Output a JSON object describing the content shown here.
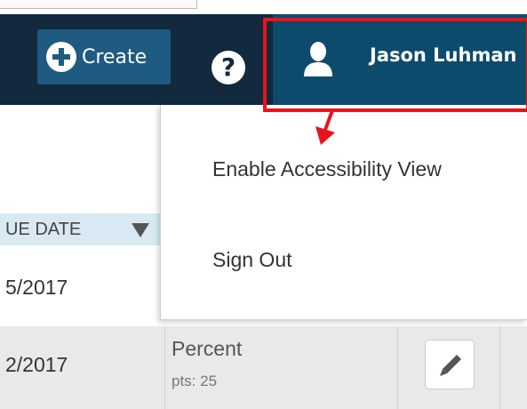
{
  "navbar": {
    "create_label": "Create",
    "help_symbol": "?",
    "user_name": "Jason Luhman",
    "icons": {
      "create": "plus-circle-icon",
      "help": "question-circle-icon",
      "user": "user-silhouette-icon"
    },
    "colors": {
      "navbar_bg": "#13293d",
      "create_bg": "#1f5a80",
      "user_menu_bg": "#0d4b6d",
      "highlight": "#e8141c"
    }
  },
  "dropdown": {
    "items": [
      {
        "label": "Enable Accessibility View"
      },
      {
        "label": "Sign Out"
      }
    ]
  },
  "table": {
    "columns": [
      {
        "label": "UE DATE",
        "sort_icon": "sort-down-triangle-icon"
      }
    ],
    "rows": [
      {
        "date": "5/2017"
      },
      {
        "date": "2/2017",
        "type": "Percent",
        "points": "pts: 25",
        "action_icon": "pencil-icon"
      }
    ]
  }
}
